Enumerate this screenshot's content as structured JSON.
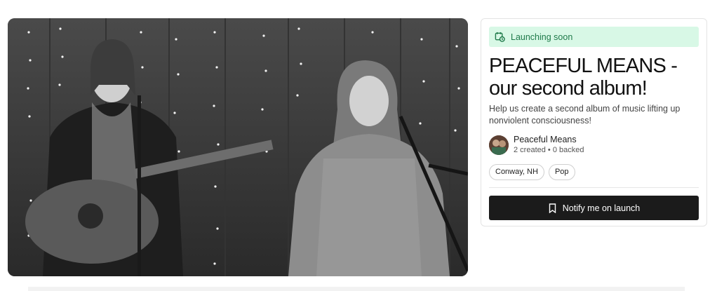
{
  "hero": {
    "alt": "Two women performing on stage with guitar and microphones"
  },
  "status": {
    "badge_label": "Launching soon",
    "badge_icon": "calendar-clock-icon",
    "accent": "#1f7a4a",
    "badge_bg": "#d8f8e6"
  },
  "project": {
    "title": "PEACEFUL MEANS - our second album!",
    "description": "Help us create a second album of music lifting up nonviolent consciousness!"
  },
  "creator": {
    "name": "Peaceful Means",
    "meta": "2 created • 0 backed"
  },
  "tags": [
    "Conway, NH",
    "Pop"
  ],
  "actions": {
    "notify_label": "Notify me on launch",
    "notify_icon": "bookmark-icon",
    "button_color": "#1b1b1b"
  }
}
